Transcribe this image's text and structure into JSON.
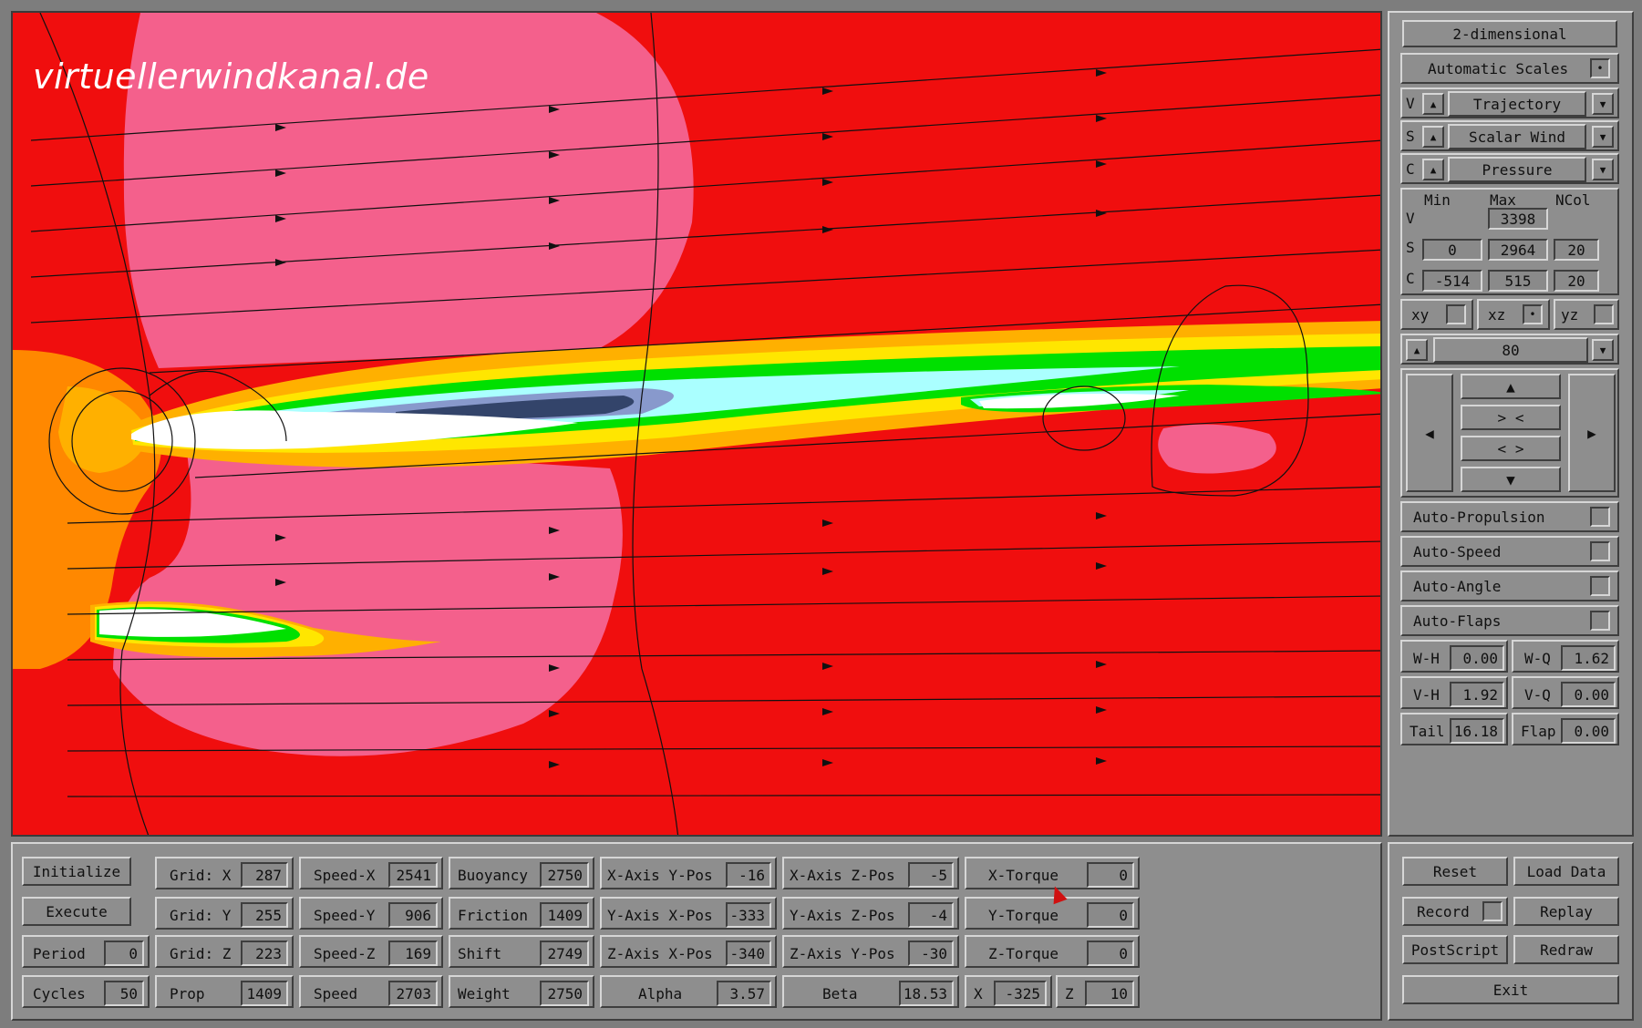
{
  "watermark": "virtuellerwindkanal.de",
  "right_panel": {
    "view_mode": "2-dimensional",
    "auto_scales": "Automatic Scales",
    "selectors": [
      {
        "key": "V",
        "value": "Trajectory"
      },
      {
        "key": "S",
        "value": "Scalar Wind"
      },
      {
        "key": "C",
        "value": "Pressure"
      }
    ],
    "scale_headers": {
      "min": "Min",
      "max": "Max",
      "ncol": "NCol"
    },
    "scale_rows": [
      {
        "key": "V",
        "min": "",
        "max": "3398",
        "ncol": ""
      },
      {
        "key": "S",
        "min": "0",
        "max": "2964",
        "ncol": "20"
      },
      {
        "key": "C",
        "min": "-514",
        "max": "515",
        "ncol": "20"
      }
    ],
    "planes": [
      {
        "label": "xy",
        "mark": ""
      },
      {
        "label": "xz",
        "mark": "•"
      },
      {
        "label": "yz",
        "mark": ""
      }
    ],
    "slice_value": "80",
    "nav": {
      "up": "▲",
      "down": "▼",
      "left": "◀",
      "right": "▶",
      "zoom_in": "> <",
      "zoom_out": "< >"
    },
    "toggles": [
      "Auto-Propulsion",
      "Auto-Speed",
      "Auto-Angle",
      "Auto-Flaps"
    ],
    "params": [
      {
        "label": "W-H",
        "value": "0.00"
      },
      {
        "label": "W-Q",
        "value": "1.62"
      },
      {
        "label": "V-H",
        "value": "1.92"
      },
      {
        "label": "V-Q",
        "value": "0.00"
      },
      {
        "label": "Tail",
        "value": "16.18"
      },
      {
        "label": "Flap",
        "value": "0.00"
      }
    ]
  },
  "bottom": {
    "buttons": [
      {
        "label": "Initialize"
      },
      {
        "label": "Execute"
      }
    ],
    "period": {
      "label": "Period",
      "value": "0"
    },
    "cycles": {
      "label": "Cycles",
      "value": "50"
    },
    "columns": [
      [
        {
          "label": "Grid: X",
          "value": "287"
        },
        {
          "label": "Grid: Y",
          "value": "255"
        },
        {
          "label": "Grid: Z",
          "value": "223"
        },
        {
          "label": "Prop",
          "value": "1409"
        }
      ],
      [
        {
          "label": "Speed-X",
          "value": "2541"
        },
        {
          "label": "Speed-Y",
          "value": "906"
        },
        {
          "label": "Speed-Z",
          "value": "169"
        },
        {
          "label": "Speed",
          "value": "2703"
        }
      ],
      [
        {
          "label": "Buoyancy",
          "value": "2750"
        },
        {
          "label": "Friction",
          "value": "1409"
        },
        {
          "label": "Shift",
          "value": "2749"
        },
        {
          "label": "Weight",
          "value": "2750"
        }
      ],
      [
        {
          "label": "X-Axis Y-Pos",
          "value": "-16"
        },
        {
          "label": "Y-Axis X-Pos",
          "value": "-333"
        },
        {
          "label": "Z-Axis X-Pos",
          "value": "-340"
        },
        {
          "label": "Alpha",
          "value": "3.57"
        }
      ],
      [
        {
          "label": "X-Axis Z-Pos",
          "value": "-5"
        },
        {
          "label": "Y-Axis Z-Pos",
          "value": "-4"
        },
        {
          "label": "Z-Axis Y-Pos",
          "value": "-30"
        },
        {
          "label": "Beta",
          "value": "18.53"
        }
      ],
      [
        {
          "label": "X-Torque",
          "value": "0"
        },
        {
          "label": "Y-Torque",
          "value": "0"
        },
        {
          "label": "Z-Torque",
          "value": "0"
        }
      ]
    ],
    "x": {
      "label": "X",
      "value": "-325"
    },
    "z": {
      "label": "Z",
      "value": "10"
    }
  },
  "bottom_right": {
    "reset": "Reset",
    "load_data": "Load Data",
    "record": "Record",
    "replay": "Replay",
    "postscript": "PostScript",
    "redraw": "Redraw",
    "exit": "Exit"
  },
  "colors": {
    "background": "#f00e0e",
    "pink": "#f4608c",
    "orange": "#ff8800",
    "yellow": "#ffe600",
    "green": "#00e000",
    "cyan": "#aaffff",
    "blue": "#5566aa",
    "panel": "#8e8e8e"
  }
}
